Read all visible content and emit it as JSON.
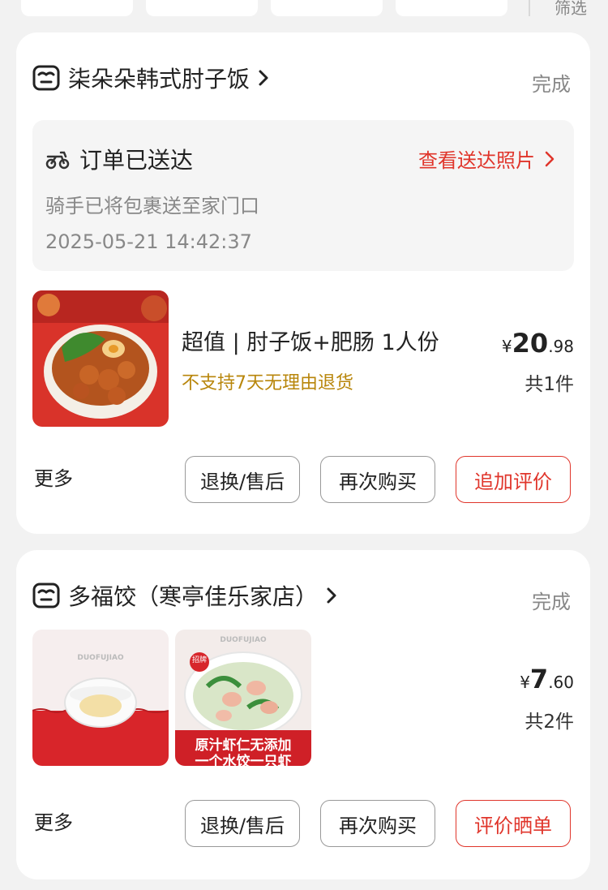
{
  "filter_bar": {
    "filter_label": "筛选"
  },
  "orders": [
    {
      "store_name": "柒朵朵韩式肘子饭",
      "status": "完成",
      "delivery": {
        "title": "订单已送达",
        "link": "查看送达照片",
        "description": "骑手已将包裹送至家门口",
        "time": "2025-05-21 14:42:37"
      },
      "item": {
        "title": "超值 | 肘子饭+肥肠 1人份",
        "note": "不支持7天无理由退货"
      },
      "price": {
        "currency": "¥",
        "integer": "20",
        "decimal": ".98"
      },
      "count": "共1件",
      "more": "更多",
      "buttons": [
        "退换/售后",
        "再次购买",
        "追加评价"
      ]
    },
    {
      "store_name": "多福饺（寒亭佳乐家店）",
      "status": "完成",
      "images": [
        {
          "caption": "DUOFUJIAO"
        },
        {
          "caption": "DUOFUJIAO",
          "badge": "招牌",
          "text_line1": "原汁虾仁无添加",
          "text_line2": "一个水饺一只虾"
        }
      ],
      "price": {
        "currency": "¥",
        "integer": "7",
        "decimal": ".60"
      },
      "count": "共2件",
      "more": "更多",
      "buttons": [
        "退换/售后",
        "再次购买",
        "评价晒单"
      ]
    }
  ],
  "colors": {
    "accent": "#e0352b",
    "note": "#b8860b",
    "muted": "#888888"
  },
  "icons": [
    "store-icon",
    "scooter-icon",
    "chevron-right-icon"
  ]
}
